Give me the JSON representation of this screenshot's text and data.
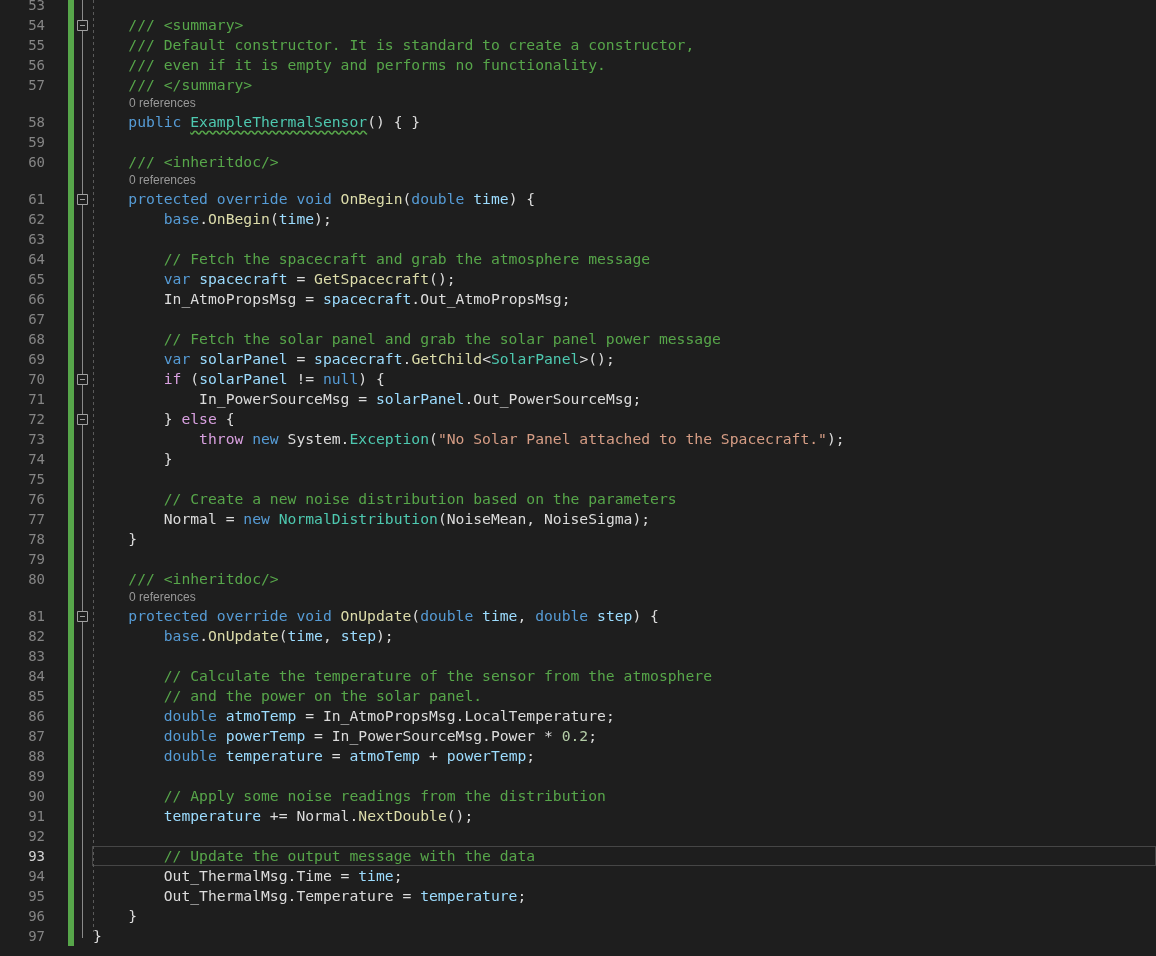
{
  "editor": {
    "lines": [
      {
        "number": "53",
        "changed": true,
        "selected": false
      },
      {
        "number": "54",
        "changed": true,
        "selected": false,
        "expanded": true,
        "tokens": [
          {
            "text": "    /// <summary>",
            "kind": "doc"
          }
        ]
      },
      {
        "number": "55",
        "changed": true,
        "selected": false,
        "tokens": [
          {
            "text": "    /// Default constructor. It is standard to create a constructor,",
            "kind": "doc"
          }
        ]
      },
      {
        "number": "56",
        "changed": true,
        "selected": false,
        "tokens": [
          {
            "text": "    /// even if it is empty and performs no functionality.",
            "kind": "doc"
          }
        ]
      },
      {
        "number": "57",
        "changed": true,
        "selected": false,
        "tokens": [
          {
            "text": "    /// </summary>",
            "kind": "doc"
          }
        ]
      },
      {
        "number": "58",
        "changed": true,
        "selected": false,
        "codelens": "0 references",
        "tokens": [
          {
            "text": "    public ",
            "kind": "kw"
          },
          {
            "text": "ExampleThermalSensor",
            "kind": "type",
            "squiggle": true
          },
          {
            "text": "() { }",
            "kind": "plain"
          }
        ]
      },
      {
        "number": "59",
        "changed": true,
        "selected": false
      },
      {
        "number": "60",
        "changed": true,
        "selected": false,
        "tokens": [
          {
            "text": "    /// <inheritdoc/>",
            "kind": "doc"
          }
        ]
      },
      {
        "number": "61",
        "changed": true,
        "selected": false,
        "expanded": true,
        "codelens": "0 references",
        "tokens": [
          {
            "text": "    protected override void ",
            "kind": "kw"
          },
          {
            "text": "OnBegin",
            "kind": "method"
          },
          {
            "text": "(",
            "kind": "plain"
          },
          {
            "text": "double ",
            "kind": "kw"
          },
          {
            "text": "time",
            "kind": "local"
          },
          {
            "text": ") {",
            "kind": "plain"
          }
        ]
      },
      {
        "number": "62",
        "changed": true,
        "selected": false,
        "tokens": [
          {
            "text": "        base",
            "kind": "kw"
          },
          {
            "text": ".",
            "kind": "plain"
          },
          {
            "text": "OnBegin",
            "kind": "method"
          },
          {
            "text": "(",
            "kind": "plain"
          },
          {
            "text": "time",
            "kind": "local"
          },
          {
            "text": ");",
            "kind": "plain"
          }
        ]
      },
      {
        "number": "63",
        "changed": true,
        "selected": false
      },
      {
        "number": "64",
        "changed": true,
        "selected": false,
        "tokens": [
          {
            "text": "        // Fetch the spacecraft and grab the atmosphere message",
            "kind": "comment"
          }
        ]
      },
      {
        "number": "65",
        "changed": true,
        "selected": false,
        "tokens": [
          {
            "text": "        var ",
            "kind": "kw"
          },
          {
            "text": "spacecraft",
            "kind": "local"
          },
          {
            "text": " = ",
            "kind": "plain"
          },
          {
            "text": "GetSpacecraft",
            "kind": "method"
          },
          {
            "text": "();",
            "kind": "plain"
          }
        ]
      },
      {
        "number": "66",
        "changed": true,
        "selected": false,
        "tokens": [
          {
            "text": "        In_AtmoPropsMsg = ",
            "kind": "plain"
          },
          {
            "text": "spacecraft",
            "kind": "local"
          },
          {
            "text": ".Out_AtmoPropsMsg;",
            "kind": "plain"
          }
        ]
      },
      {
        "number": "67",
        "changed": true,
        "selected": false
      },
      {
        "number": "68",
        "changed": true,
        "selected": false,
        "tokens": [
          {
            "text": "        // Fetch the solar panel and grab the solar panel power message",
            "kind": "comment"
          }
        ]
      },
      {
        "number": "69",
        "changed": true,
        "selected": false,
        "tokens": [
          {
            "text": "        var ",
            "kind": "kw"
          },
          {
            "text": "solarPanel",
            "kind": "local"
          },
          {
            "text": " = ",
            "kind": "plain"
          },
          {
            "text": "spacecraft",
            "kind": "local"
          },
          {
            "text": ".",
            "kind": "plain"
          },
          {
            "text": "GetChild",
            "kind": "method"
          },
          {
            "text": "<",
            "kind": "plain"
          },
          {
            "text": "SolarPanel",
            "kind": "type"
          },
          {
            "text": ">();",
            "kind": "plain"
          }
        ]
      },
      {
        "number": "70",
        "changed": true,
        "selected": false,
        "expanded": true,
        "tokens": [
          {
            "text": "        if",
            "kind": "ctrl"
          },
          {
            "text": " (",
            "kind": "plain"
          },
          {
            "text": "solarPanel",
            "kind": "local"
          },
          {
            "text": " != ",
            "kind": "plain"
          },
          {
            "text": "null",
            "kind": "kw"
          },
          {
            "text": ") {",
            "kind": "plain"
          }
        ]
      },
      {
        "number": "71",
        "changed": true,
        "selected": false,
        "tokens": [
          {
            "text": "            In_PowerSourceMsg = ",
            "kind": "plain"
          },
          {
            "text": "solarPanel",
            "kind": "local"
          },
          {
            "text": ".Out_PowerSourceMsg;",
            "kind": "plain"
          }
        ]
      },
      {
        "number": "72",
        "changed": true,
        "selected": false,
        "expanded": true,
        "tokens": [
          {
            "text": "        } ",
            "kind": "plain"
          },
          {
            "text": "else",
            "kind": "ctrl"
          },
          {
            "text": " {",
            "kind": "plain"
          }
        ]
      },
      {
        "number": "73",
        "changed": true,
        "selected": false,
        "tokens": [
          {
            "text": "            throw",
            "kind": "ctrl"
          },
          {
            "text": " new",
            "kind": "kw"
          },
          {
            "text": " System.",
            "kind": "plain"
          },
          {
            "text": "Exception",
            "kind": "type"
          },
          {
            "text": "(",
            "kind": "plain"
          },
          {
            "text": "\"No Solar Panel attached to the Spacecraft.\"",
            "kind": "string"
          },
          {
            "text": ");",
            "kind": "plain"
          }
        ]
      },
      {
        "number": "74",
        "changed": true,
        "selected": false,
        "tokens": [
          {
            "text": "        }",
            "kind": "plain"
          }
        ]
      },
      {
        "number": "75",
        "changed": true,
        "selected": false
      },
      {
        "number": "76",
        "changed": true,
        "selected": false,
        "tokens": [
          {
            "text": "        // Create a new noise distribution based on the parameters",
            "kind": "comment"
          }
        ]
      },
      {
        "number": "77",
        "changed": true,
        "selected": false,
        "tokens": [
          {
            "text": "        Normal = ",
            "kind": "plain"
          },
          {
            "text": "new ",
            "kind": "kw"
          },
          {
            "text": "NormalDistribution",
            "kind": "type"
          },
          {
            "text": "(NoiseMean, NoiseSigma);",
            "kind": "plain"
          }
        ]
      },
      {
        "number": "78",
        "changed": true,
        "selected": false,
        "tokens": [
          {
            "text": "    }",
            "kind": "plain"
          }
        ]
      },
      {
        "number": "79",
        "changed": true,
        "selected": false
      },
      {
        "number": "80",
        "changed": true,
        "selected": false,
        "tokens": [
          {
            "text": "    /// <inheritdoc/>",
            "kind": "doc"
          }
        ]
      },
      {
        "number": "81",
        "changed": true,
        "selected": false,
        "expanded": true,
        "codelens": "0 references",
        "tokens": [
          {
            "text": "    protected override void ",
            "kind": "kw"
          },
          {
            "text": "OnUpdate",
            "kind": "method"
          },
          {
            "text": "(",
            "kind": "plain"
          },
          {
            "text": "double ",
            "kind": "kw"
          },
          {
            "text": "time",
            "kind": "local"
          },
          {
            "text": ", ",
            "kind": "plain"
          },
          {
            "text": "double ",
            "kind": "kw"
          },
          {
            "text": "step",
            "kind": "local"
          },
          {
            "text": ") {",
            "kind": "plain"
          }
        ]
      },
      {
        "number": "82",
        "changed": true,
        "selected": false,
        "tokens": [
          {
            "text": "        base",
            "kind": "kw"
          },
          {
            "text": ".",
            "kind": "plain"
          },
          {
            "text": "OnUpdate",
            "kind": "method"
          },
          {
            "text": "(",
            "kind": "plain"
          },
          {
            "text": "time",
            "kind": "local"
          },
          {
            "text": ", ",
            "kind": "plain"
          },
          {
            "text": "step",
            "kind": "local"
          },
          {
            "text": ");",
            "kind": "plain"
          }
        ]
      },
      {
        "number": "83",
        "changed": true,
        "selected": false
      },
      {
        "number": "84",
        "changed": true,
        "selected": false,
        "tokens": [
          {
            "text": "        // Calculate the temperature of the sensor from the atmosphere",
            "kind": "comment"
          }
        ]
      },
      {
        "number": "85",
        "changed": true,
        "selected": false,
        "tokens": [
          {
            "text": "        // and the power on the solar panel.",
            "kind": "comment"
          }
        ]
      },
      {
        "number": "86",
        "changed": true,
        "selected": false,
        "tokens": [
          {
            "text": "        double ",
            "kind": "kw"
          },
          {
            "text": "atmoTemp",
            "kind": "local"
          },
          {
            "text": " = In_AtmoPropsMsg.LocalTemperature;",
            "kind": "plain"
          }
        ]
      },
      {
        "number": "87",
        "changed": true,
        "selected": false,
        "tokens": [
          {
            "text": "        double ",
            "kind": "kw"
          },
          {
            "text": "powerTemp",
            "kind": "local"
          },
          {
            "text": " = In_PowerSourceMsg.Power * ",
            "kind": "plain"
          },
          {
            "text": "0.2",
            "kind": "number"
          },
          {
            "text": ";",
            "kind": "plain"
          }
        ]
      },
      {
        "number": "88",
        "changed": true,
        "selected": false,
        "tokens": [
          {
            "text": "        double ",
            "kind": "kw"
          },
          {
            "text": "temperature",
            "kind": "local"
          },
          {
            "text": " = ",
            "kind": "plain"
          },
          {
            "text": "atmoTemp",
            "kind": "local"
          },
          {
            "text": " + ",
            "kind": "plain"
          },
          {
            "text": "powerTemp",
            "kind": "local"
          },
          {
            "text": ";",
            "kind": "plain"
          }
        ]
      },
      {
        "number": "89",
        "changed": true,
        "selected": false
      },
      {
        "number": "90",
        "changed": true,
        "selected": false,
        "tokens": [
          {
            "text": "        // Apply some noise readings from the distribution",
            "kind": "comment"
          }
        ]
      },
      {
        "number": "91",
        "changed": true,
        "selected": false,
        "tokens": [
          {
            "text": "        temperature",
            "kind": "local"
          },
          {
            "text": " += Normal.",
            "kind": "plain"
          },
          {
            "text": "NextDouble",
            "kind": "method"
          },
          {
            "text": "();",
            "kind": "plain"
          }
        ]
      },
      {
        "number": "92",
        "changed": true,
        "selected": false
      },
      {
        "number": "93",
        "changed": true,
        "selected": true,
        "tokens": [
          {
            "text": "        // Update the output message with the data",
            "kind": "comment"
          }
        ]
      },
      {
        "number": "94",
        "changed": true,
        "selected": false,
        "tokens": [
          {
            "text": "        Out_ThermalMsg.Time = ",
            "kind": "plain"
          },
          {
            "text": "time",
            "kind": "local"
          },
          {
            "text": ";",
            "kind": "plain"
          }
        ]
      },
      {
        "number": "95",
        "changed": true,
        "selected": false,
        "tokens": [
          {
            "text": "        Out_ThermalMsg.Temperature = ",
            "kind": "plain"
          },
          {
            "text": "temperature",
            "kind": "local"
          },
          {
            "text": ";",
            "kind": "plain"
          }
        ]
      },
      {
        "number": "96",
        "changed": true,
        "selected": false,
        "tokens": [
          {
            "text": "    }",
            "kind": "plain"
          }
        ]
      },
      {
        "number": "97",
        "changed": true,
        "selected": false,
        "tokens": [
          {
            "text": "}",
            "kind": "plain"
          }
        ]
      }
    ]
  }
}
